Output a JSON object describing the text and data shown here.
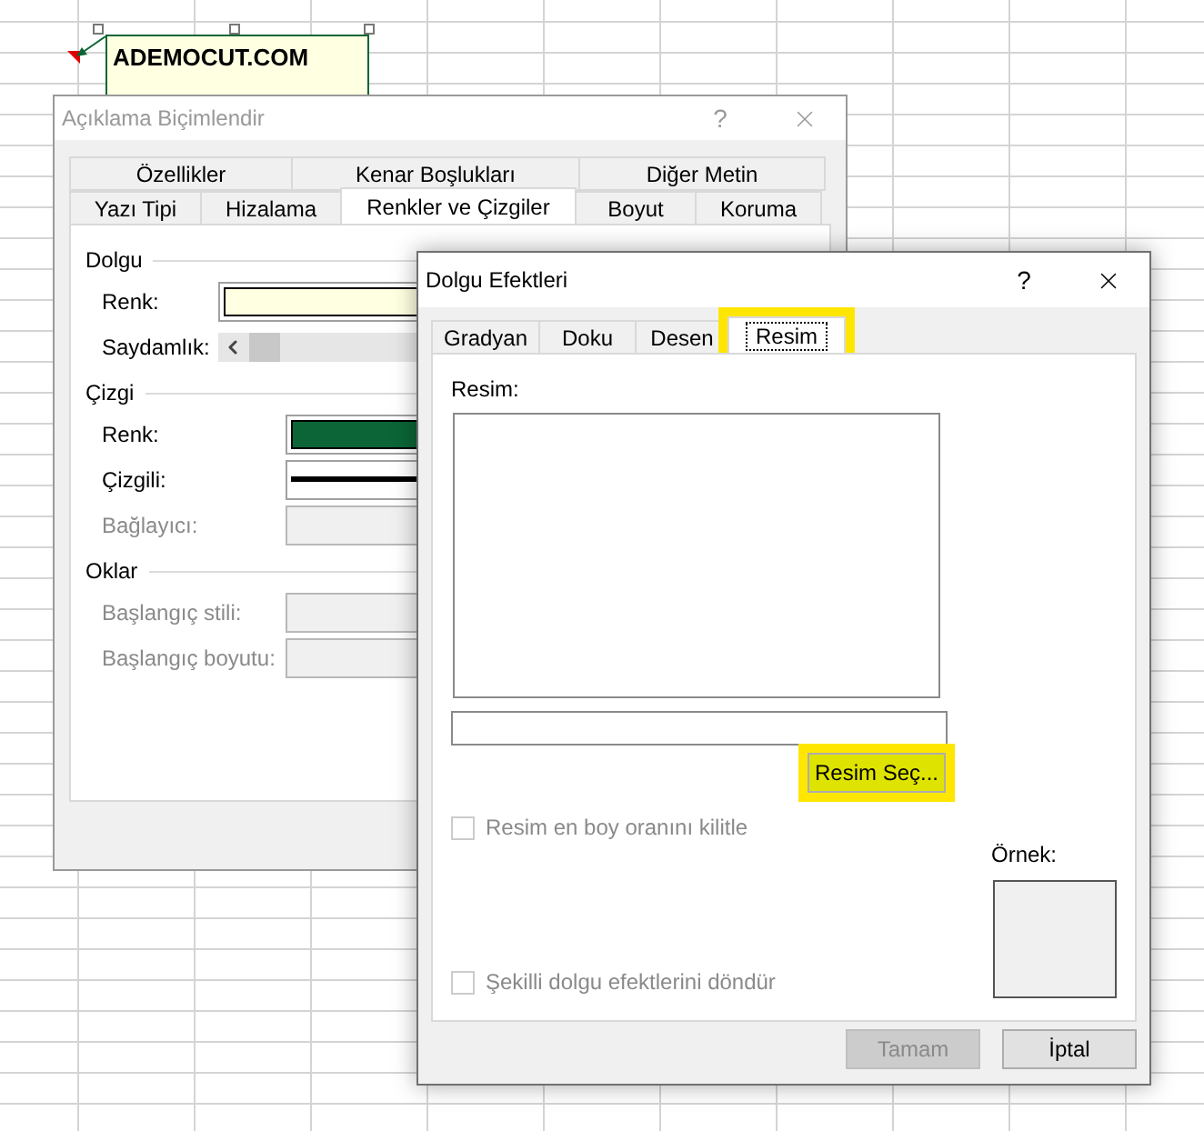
{
  "comment": {
    "text": "ADEMOCUT.COM"
  },
  "format_dialog": {
    "title": "Açıklama Biçimlendir",
    "help": "?",
    "tabs_row_1": [
      {
        "label": "Özellikler",
        "selected": false
      },
      {
        "label": "Kenar Boşlukları",
        "selected": false
      },
      {
        "label": "Diğer Metin",
        "selected": false
      }
    ],
    "tabs_row_2": [
      {
        "label": "Yazı Tipi",
        "selected": false
      },
      {
        "label": "Hizalama",
        "selected": false
      },
      {
        "label": "Renkler ve Çizgiler",
        "selected": true
      },
      {
        "label": "Boyut",
        "selected": false
      },
      {
        "label": "Koruma",
        "selected": false
      }
    ],
    "sections": [
      {
        "title": "Dolgu",
        "fields": [
          {
            "kind": "color",
            "label": "Renk:",
            "color": "#ffffe1",
            "disabled": false
          },
          {
            "kind": "slider",
            "label": "Saydamlık:",
            "level": 0,
            "disabled": false
          }
        ]
      },
      {
        "title": "Çizgi",
        "fields": [
          {
            "kind": "color",
            "label": "Renk:",
            "color": "#0c6536",
            "disabled": false
          },
          {
            "kind": "line",
            "label": "Çizgili:",
            "disabled": false
          },
          {
            "kind": "dropdown",
            "label": "Bağlayıcı:",
            "disabled": true
          }
        ]
      },
      {
        "title": "Oklar",
        "fields": [
          {
            "kind": "dropdown",
            "label": "Başlangıç stili:",
            "disabled": true
          },
          {
            "kind": "dropdown",
            "label": "Başlangıç boyutu:",
            "disabled": true
          }
        ]
      }
    ]
  },
  "fill_dialog": {
    "title": "Dolgu Efektleri",
    "help": "?",
    "tabs": [
      {
        "label": "Gradyan",
        "selected": false,
        "highlighted": false
      },
      {
        "label": "Doku",
        "selected": false,
        "highlighted": false
      },
      {
        "label": "Desen",
        "selected": false,
        "highlighted": false
      },
      {
        "label": "Resim",
        "selected": true,
        "highlighted": true
      }
    ],
    "picture_label": "Resim:",
    "select_button": {
      "label": "Resim Seç...",
      "highlighted": true
    },
    "checkboxes": [
      {
        "label": "Resim en boy oranını kilitle",
        "checked": false,
        "disabled": true
      },
      {
        "label": "Şekilli dolgu efektlerini döndür",
        "checked": false,
        "disabled": true
      }
    ],
    "sample_label": "Örnek:",
    "buttons": [
      {
        "label": "Tamam",
        "disabled": true
      },
      {
        "label": "İptal",
        "disabled": false
      }
    ]
  }
}
